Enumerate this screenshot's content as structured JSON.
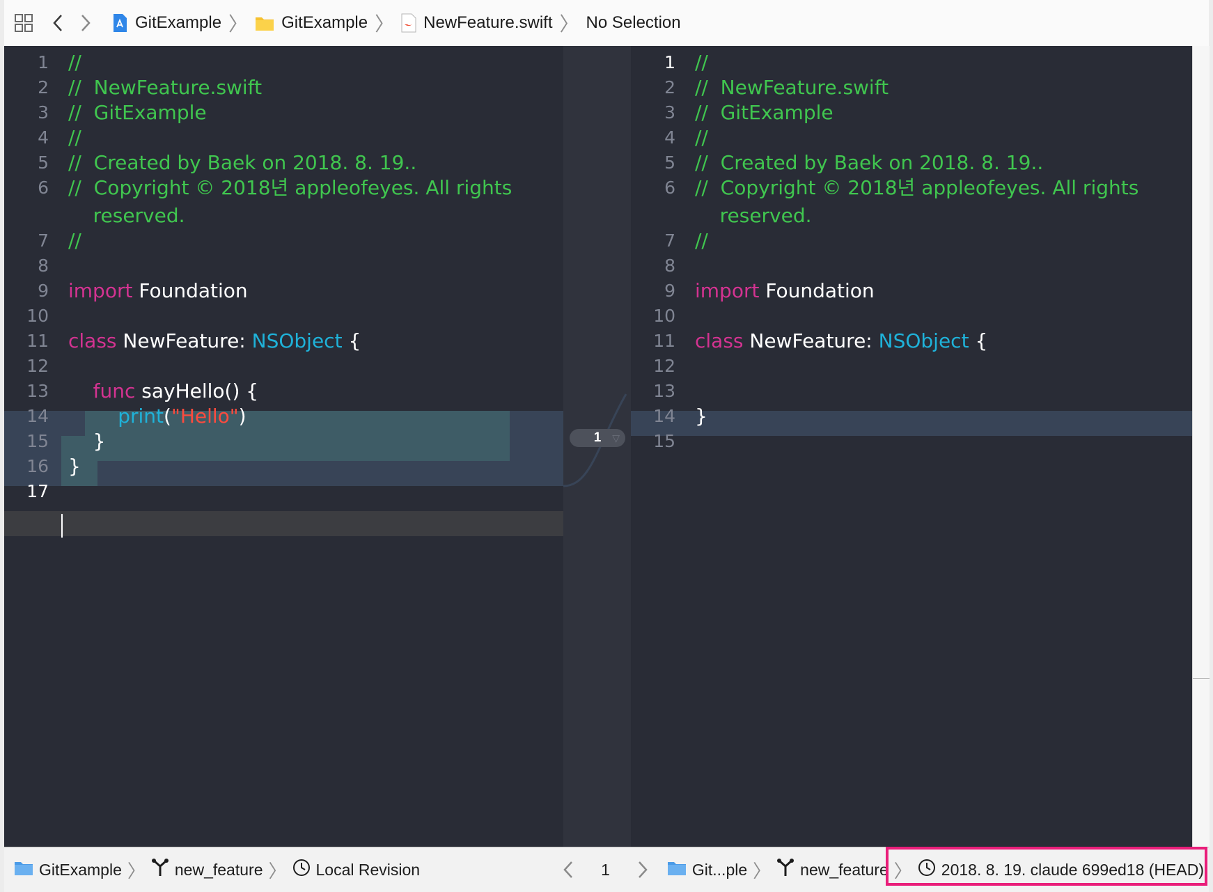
{
  "jump_bar": {
    "crumbs": [
      "GitExample",
      "GitExample",
      "NewFeature.swift",
      "No Selection"
    ]
  },
  "left_editor": {
    "lines": [
      {
        "n": "1",
        "tokens": [
          {
            "t": "//",
            "k": "comment"
          }
        ]
      },
      {
        "n": "2",
        "tokens": [
          {
            "t": "//  NewFeature.swift",
            "k": "comment"
          }
        ]
      },
      {
        "n": "3",
        "tokens": [
          {
            "t": "//  GitExample",
            "k": "comment"
          }
        ]
      },
      {
        "n": "4",
        "tokens": [
          {
            "t": "//",
            "k": "comment"
          }
        ]
      },
      {
        "n": "5",
        "tokens": [
          {
            "t": "//  Created by Baek on 2018. 8. 19..",
            "k": "comment"
          }
        ]
      },
      {
        "n": "6",
        "tokens": [
          {
            "t": "//  Copyright © 2018년 appleofeyes. All rights",
            "k": "comment"
          }
        ]
      },
      {
        "n": "",
        "tokens": [
          {
            "t": "    reserved.",
            "k": "comment"
          }
        ]
      },
      {
        "n": "7",
        "tokens": [
          {
            "t": "//",
            "k": "comment"
          }
        ]
      },
      {
        "n": "8",
        "tokens": []
      },
      {
        "n": "9",
        "tokens": [
          {
            "t": "import",
            "k": "kw"
          },
          {
            "t": " Foundation",
            "k": "plain"
          }
        ]
      },
      {
        "n": "10",
        "tokens": []
      },
      {
        "n": "11",
        "tokens": [
          {
            "t": "class",
            "k": "kw"
          },
          {
            "t": " NewFeature: ",
            "k": "plain"
          },
          {
            "t": "NSObject",
            "k": "type"
          },
          {
            "t": " {",
            "k": "plain"
          }
        ]
      },
      {
        "n": "12",
        "tokens": []
      },
      {
        "n": "13",
        "tokens": [
          {
            "t": "    ",
            "k": "plain"
          },
          {
            "t": "func",
            "k": "kw"
          },
          {
            "t": " sayHello() {",
            "k": "plain"
          }
        ]
      },
      {
        "n": "14",
        "tokens": [
          {
            "t": "        ",
            "k": "plain"
          },
          {
            "t": "print",
            "k": "type"
          },
          {
            "t": "(",
            "k": "plain"
          },
          {
            "t": "\"Hello\"",
            "k": "str"
          },
          {
            "t": ")",
            "k": "plain"
          }
        ]
      },
      {
        "n": "15",
        "tokens": [
          {
            "t": "    }",
            "k": "plain"
          }
        ]
      },
      {
        "n": "16",
        "tokens": [
          {
            "t": "}",
            "k": "plain"
          }
        ]
      },
      {
        "n": "17",
        "tokens": []
      }
    ]
  },
  "right_editor": {
    "lines": [
      {
        "n": "1",
        "tokens": [
          {
            "t": "//",
            "k": "comment"
          }
        ]
      },
      {
        "n": "2",
        "tokens": [
          {
            "t": "//  NewFeature.swift",
            "k": "comment"
          }
        ]
      },
      {
        "n": "3",
        "tokens": [
          {
            "t": "//  GitExample",
            "k": "comment"
          }
        ]
      },
      {
        "n": "4",
        "tokens": [
          {
            "t": "//",
            "k": "comment"
          }
        ]
      },
      {
        "n": "5",
        "tokens": [
          {
            "t": "//  Created by Baek on 2018. 8. 19..",
            "k": "comment"
          }
        ]
      },
      {
        "n": "6",
        "tokens": [
          {
            "t": "//  Copyright © 2018년 appleofeyes. All rights",
            "k": "comment"
          }
        ]
      },
      {
        "n": "",
        "tokens": [
          {
            "t": "    reserved.",
            "k": "comment"
          }
        ]
      },
      {
        "n": "7",
        "tokens": [
          {
            "t": "//",
            "k": "comment"
          }
        ]
      },
      {
        "n": "8",
        "tokens": []
      },
      {
        "n": "9",
        "tokens": [
          {
            "t": "import",
            "k": "kw"
          },
          {
            "t": " Foundation",
            "k": "plain"
          }
        ]
      },
      {
        "n": "10",
        "tokens": []
      },
      {
        "n": "11",
        "tokens": [
          {
            "t": "class",
            "k": "kw"
          },
          {
            "t": " NewFeature: ",
            "k": "plain"
          },
          {
            "t": "NSObject",
            "k": "type"
          },
          {
            "t": " {",
            "k": "plain"
          }
        ]
      },
      {
        "n": "12",
        "tokens": []
      },
      {
        "n": "13",
        "tokens": []
      },
      {
        "n": "14",
        "tokens": [
          {
            "t": "}",
            "k": "plain"
          }
        ]
      },
      {
        "n": "15",
        "tokens": []
      }
    ]
  },
  "diff": {
    "change_count": "1"
  },
  "bottom_bar": {
    "left": {
      "repo": "GitExample",
      "branch": "new_feature",
      "revision": "Local Revision"
    },
    "center": {
      "change_index": "1"
    },
    "right": {
      "repo": "Git...ple",
      "branch": "new_feature",
      "commit": "2018. 8. 19.  claude  699ed18 (HEAD)"
    }
  },
  "colors": {
    "comment": "#40c64f",
    "keyword": "#d33391",
    "type": "#1fb2d9",
    "string": "#fc4b3e",
    "highlight_box": "#e91e7a"
  }
}
